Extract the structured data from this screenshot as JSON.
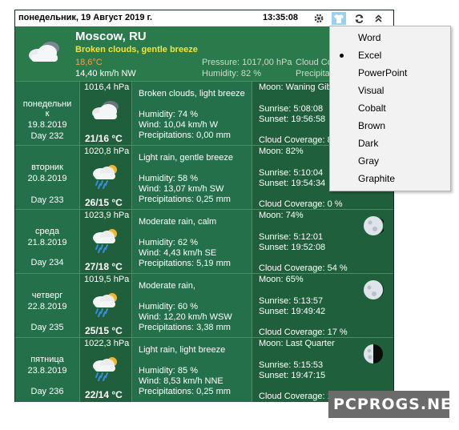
{
  "titlebar": {
    "date": "понедельник, 19 Август 2019 г.",
    "time": "13:35:08",
    "icons": [
      "gear-icon",
      "shirt-icon",
      "refresh-icon",
      "collapse-icon"
    ]
  },
  "current": {
    "city": "Moscow, RU",
    "description": "Broken clouds, gentle breeze",
    "temperature": "18,6°C",
    "wind": "14,40 km/h NW",
    "pressure": "Pressure: 1017,00 hPa",
    "humidity": "Humidity: 82 %",
    "cloud_coverage": "Cloud Co",
    "precipitation": "Precipita",
    "icon": "partly-cloudy-icon"
  },
  "forecast": [
    {
      "day_lines": [
        "понедельни",
        "к",
        "19.8.2019",
        "Day 232"
      ],
      "pressure": "1016,4 hPa",
      "temp": "21/16 °C",
      "icon": "cloudy-icon",
      "conditions": "Broken clouds, light breeze",
      "humidity": "Humidity: 74 %",
      "wind": "Wind: 10,04 km/h W",
      "precip": "Precipitations: 0,00 mm",
      "moon": "Moon: Waning Gib",
      "sunrise": "Sunrise: 5:08:08",
      "sunset": "Sunset: 19:56:58",
      "clouds": "Cloud Coverage: 8",
      "moon_icon": "none"
    },
    {
      "day_lines": [
        "вторник",
        "20.8.2019",
        "",
        "Day 233"
      ],
      "pressure": "1020,8 hPa",
      "temp": "26/15 °C",
      "icon": "rain-sun-icon",
      "conditions": "Light rain, gentle breeze",
      "humidity": "Humidity: 58 %",
      "wind": "Wind: 13,07 km/h SW",
      "precip": "Precipitations: 0,25 mm",
      "moon": "Moon: 82%",
      "sunrise": "Sunrise: 5:10:04",
      "sunset": "Sunset: 19:54:34",
      "clouds": "Cloud Coverage: 0 %",
      "moon_icon": "none"
    },
    {
      "day_lines": [
        "среда",
        "21.8.2019",
        "",
        "Day 234"
      ],
      "pressure": "1023,9 hPa",
      "temp": "27/18 °C",
      "icon": "rain-sun-icon",
      "conditions": "Moderate rain, calm",
      "humidity": "Humidity: 62 %",
      "wind": "Wind: 4,43 km/h SE",
      "precip": "Precipitations: 5,19 mm",
      "moon": "Moon: 74%",
      "sunrise": "Sunrise: 5:12:01",
      "sunset": "Sunset: 19:52:08",
      "clouds": "Cloud Coverage: 54 %",
      "moon_icon": "moon-gibbous-icon"
    },
    {
      "day_lines": [
        "четверг",
        "22.8.2019",
        "",
        "Day 235"
      ],
      "pressure": "1019,5 hPa",
      "temp": "25/15 °C",
      "icon": "rain-sun-icon",
      "conditions": "Moderate rain,",
      "humidity": "Humidity: 60 %",
      "wind": "Wind: 12,20 km/h WSW",
      "precip": "Precipitations: 3,38 mm",
      "moon": "Moon: 65%",
      "sunrise": "Sunrise: 5:13:57",
      "sunset": "Sunset: 19:49:42",
      "clouds": "Cloud Coverage: 17 %",
      "moon_icon": "moon-gibbous-icon"
    },
    {
      "day_lines": [
        "пятница",
        "23.8.2019",
        "",
        "Day 236"
      ],
      "pressure": "1022,3 hPa",
      "temp": "22/14 °C",
      "icon": "rain-sun-icon",
      "conditions": "Light rain, light breeze",
      "humidity": "Humidity: 85 %",
      "wind": "Wind: 8,53 km/h NNE",
      "precip": "Precipitations: 0,25 mm",
      "moon": "Moon: Last Quarter",
      "sunrise": "Sunrise: 5:15:53",
      "sunset": "Sunset: 19:47:15",
      "clouds": "Cloud Coverage: 100 %",
      "moon_icon": "moon-last-quarter-icon"
    }
  ],
  "theme_menu": {
    "items": [
      "Word",
      "Excel",
      "PowerPoint",
      "Visual",
      "Cobalt",
      "Brown",
      "Dark",
      "Gray",
      "Graphite"
    ],
    "selected": "Excel"
  },
  "watermark": "PCPROGS.NET",
  "colors": {
    "panel_dark": "#1f5f3c",
    "panel_mid": "#24704a",
    "header_green": "#2b7a4b",
    "description_yellow": "#f2e33a",
    "temperature_orange": "#ff9a4b",
    "active_icon_blue": "#9bd1f0"
  }
}
